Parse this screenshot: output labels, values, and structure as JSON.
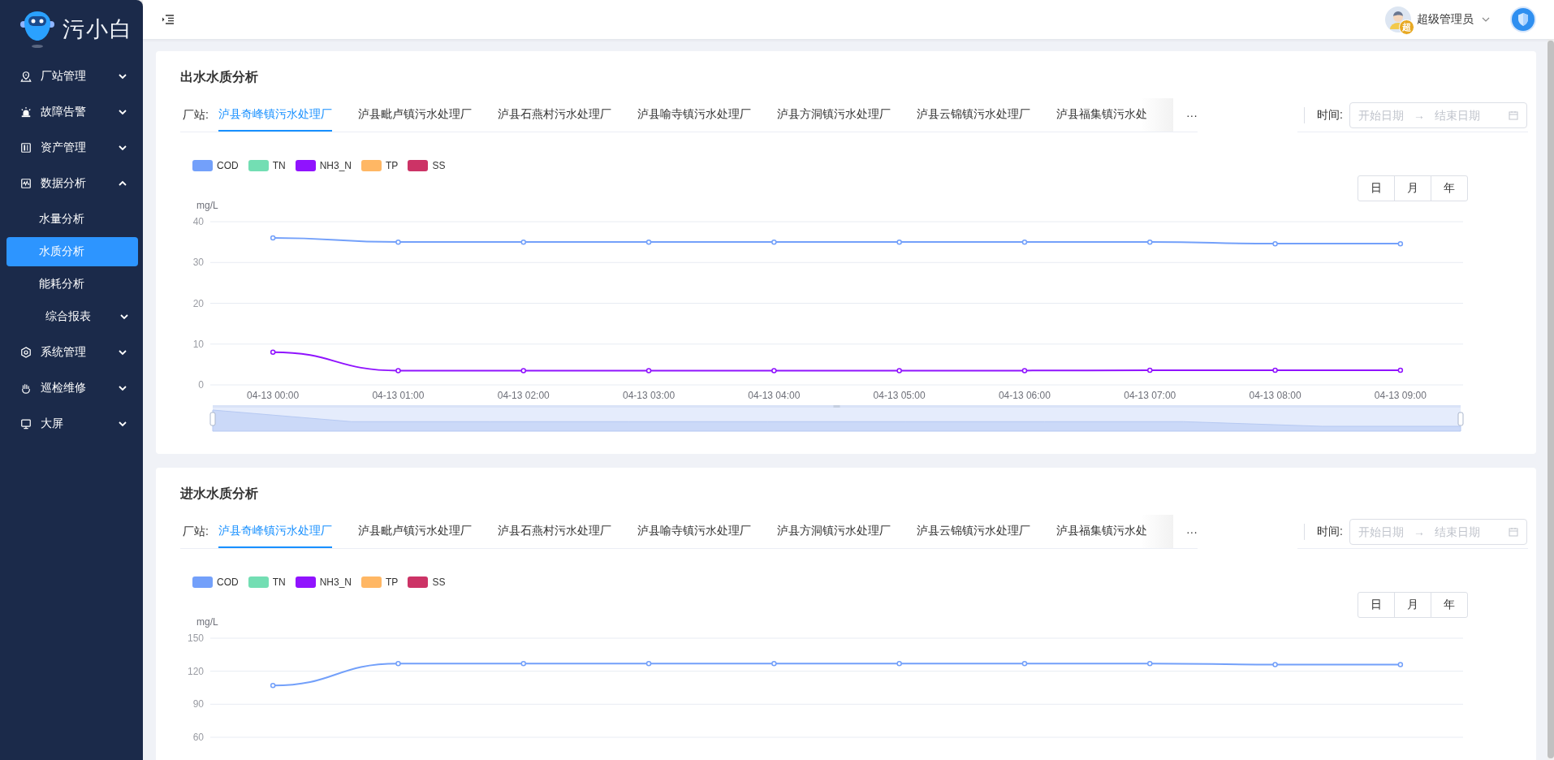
{
  "sidebar": {
    "logo_text": "污小白",
    "items": [
      {
        "label": "厂站管理",
        "expanded": false
      },
      {
        "label": "故障告警",
        "expanded": false
      },
      {
        "label": "资产管理",
        "expanded": false
      },
      {
        "label": "数据分析",
        "expanded": true,
        "children": [
          {
            "label": "水量分析",
            "kind": "link",
            "selected": false
          },
          {
            "label": "水质分析",
            "kind": "link",
            "selected": true
          },
          {
            "label": "能耗分析",
            "kind": "link",
            "selected": false
          },
          {
            "label": "综合报表",
            "kind": "group",
            "selected": false,
            "expanded": false
          }
        ]
      },
      {
        "label": "系统管理",
        "expanded": false
      },
      {
        "label": "巡检维修",
        "expanded": false
      },
      {
        "label": "大屏",
        "expanded": false
      }
    ]
  },
  "header": {
    "user": {
      "name": "超级管理员",
      "badge": "超"
    }
  },
  "cards": [
    {
      "title": "出水水质分析",
      "station_label": "厂站:",
      "stations": [
        {
          "label": "泸县奇峰镇污水处理厂",
          "selected": true
        },
        {
          "label": "泸县毗卢镇污水处理厂",
          "selected": false
        },
        {
          "label": "泸县石燕村污水处理厂",
          "selected": false
        },
        {
          "label": "泸县喻寺镇污水处理厂",
          "selected": false
        },
        {
          "label": "泸县方洞镇污水处理厂",
          "selected": false
        },
        {
          "label": "泸县云锦镇污水处理厂",
          "selected": false
        },
        {
          "label": "泸县福集镇污水处",
          "selected": false
        }
      ],
      "more": "···",
      "time_label": "时间:",
      "date_range": {
        "start_placeholder": "开始日期",
        "separator": "→",
        "end_placeholder": "结束日期"
      },
      "periods": [
        "日",
        "月",
        "年"
      ],
      "chart_data": {
        "type": "line",
        "grid": true,
        "ylabel": "mg/L",
        "categories": [
          "04-13 00:00",
          "04-13 01:00",
          "04-13 02:00",
          "04-13 03:00",
          "04-13 04:00",
          "04-13 05:00",
          "04-13 06:00",
          "04-13 07:00",
          "04-13 08:00",
          "04-13 09:00"
        ],
        "ylim": [
          0,
          40
        ],
        "yticks": [
          0,
          10,
          20,
          30,
          40
        ],
        "series": [
          {
            "name": "COD",
            "color": "#73a0fa",
            "marker": true,
            "values": [
              36,
              35,
              35,
              35,
              35,
              35,
              35,
              35,
              34.6,
              34.6
            ]
          },
          {
            "name": "TN",
            "color": "#73deb3",
            "values": [
              null,
              null,
              null,
              null,
              null,
              null,
              null,
              null,
              null,
              null
            ]
          },
          {
            "name": "NH3_N",
            "color": "#9013fe",
            "marker": true,
            "values": [
              8,
              3.5,
              3.5,
              3.5,
              3.5,
              3.5,
              3.5,
              3.6,
              3.6,
              3.6
            ]
          },
          {
            "name": "TP",
            "color": "#ffb764",
            "values": [
              null,
              null,
              null,
              null,
              null,
              null,
              null,
              null,
              null,
              null
            ]
          },
          {
            "name": "SS",
            "color": "#cc3366",
            "values": [
              null,
              null,
              null,
              null,
              null,
              null,
              null,
              null,
              null,
              null
            ]
          }
        ]
      }
    },
    {
      "title": "进水水质分析",
      "station_label": "厂站:",
      "stations": [
        {
          "label": "泸县奇峰镇污水处理厂",
          "selected": true
        },
        {
          "label": "泸县毗卢镇污水处理厂",
          "selected": false
        },
        {
          "label": "泸县石燕村污水处理厂",
          "selected": false
        },
        {
          "label": "泸县喻寺镇污水处理厂",
          "selected": false
        },
        {
          "label": "泸县方洞镇污水处理厂",
          "selected": false
        },
        {
          "label": "泸县云锦镇污水处理厂",
          "selected": false
        },
        {
          "label": "泸县福集镇污水处",
          "selected": false
        }
      ],
      "more": "···",
      "time_label": "时间:",
      "date_range": {
        "start_placeholder": "开始日期",
        "separator": "→",
        "end_placeholder": "结束日期"
      },
      "periods": [
        "日",
        "月",
        "年"
      ],
      "chart_data": {
        "type": "line",
        "grid": true,
        "ylabel": "mg/L",
        "ylim": [
          60,
          150
        ],
        "yticks": [
          60,
          90,
          120,
          150
        ],
        "series": [
          {
            "name": "COD",
            "color": "#73a0fa",
            "marker": true,
            "values": [
              107,
              127,
              127,
              127,
              127,
              127,
              127,
              127,
              126,
              126
            ]
          },
          {
            "name": "TN",
            "color": "#73deb3",
            "values": [
              null,
              null,
              null,
              null,
              null,
              null,
              null,
              null,
              null,
              null
            ]
          },
          {
            "name": "NH3_N",
            "color": "#9013fe",
            "values": [
              null,
              null,
              null,
              null,
              null,
              null,
              null,
              null,
              null,
              null
            ]
          },
          {
            "name": "TP",
            "color": "#ffb764",
            "values": [
              null,
              null,
              null,
              null,
              null,
              null,
              null,
              null,
              null,
              null
            ]
          },
          {
            "name": "SS",
            "color": "#cc3366",
            "values": [
              null,
              null,
              null,
              null,
              null,
              null,
              null,
              null,
              null,
              null
            ]
          }
        ]
      }
    }
  ]
}
